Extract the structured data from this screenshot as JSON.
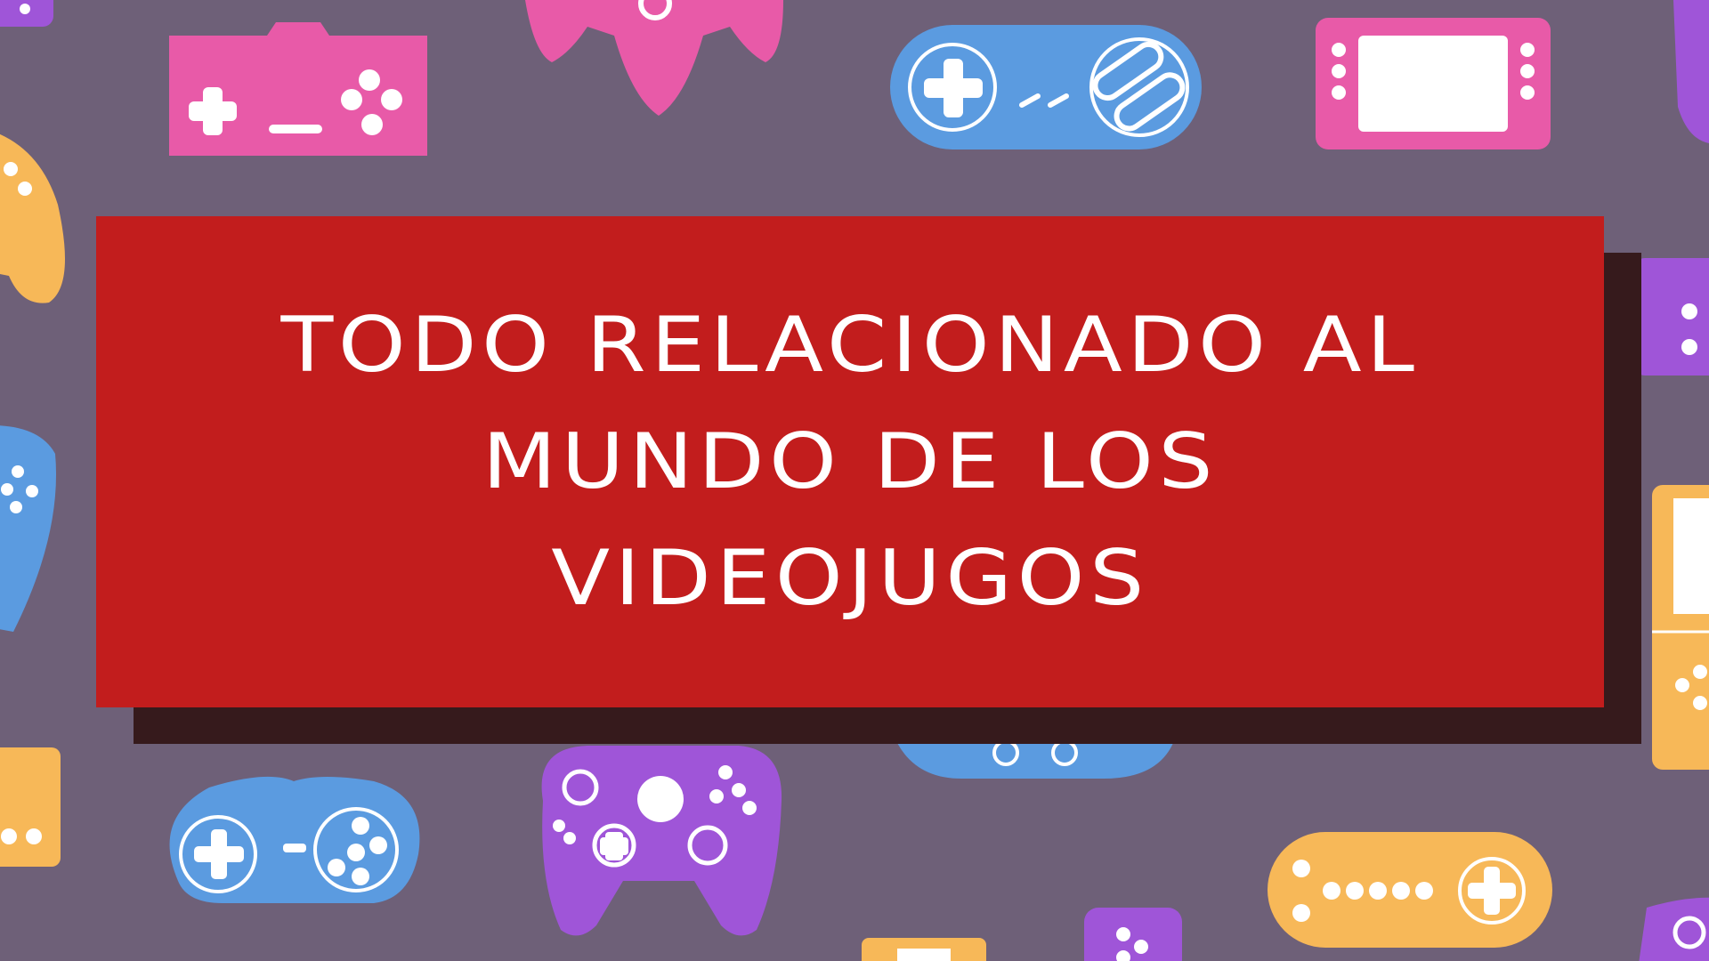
{
  "banner": {
    "title_lines": [
      "TODO RELACIONADO AL",
      "MUNDO DE LOS",
      "VIDEOJUGOS"
    ]
  },
  "colors": {
    "background": "#6e6078",
    "banner": "#c21d1d",
    "banner_shadow": "#361a1c",
    "text": "#ffffff",
    "pink": "#e85aa8",
    "blue": "#5b9be0",
    "yellow": "#f7b858",
    "purple": "#9f55d8"
  },
  "background_icons": [
    "gamepad-icon",
    "handheld-console-icon",
    "joystick-icon",
    "retro-controller-icon"
  ]
}
